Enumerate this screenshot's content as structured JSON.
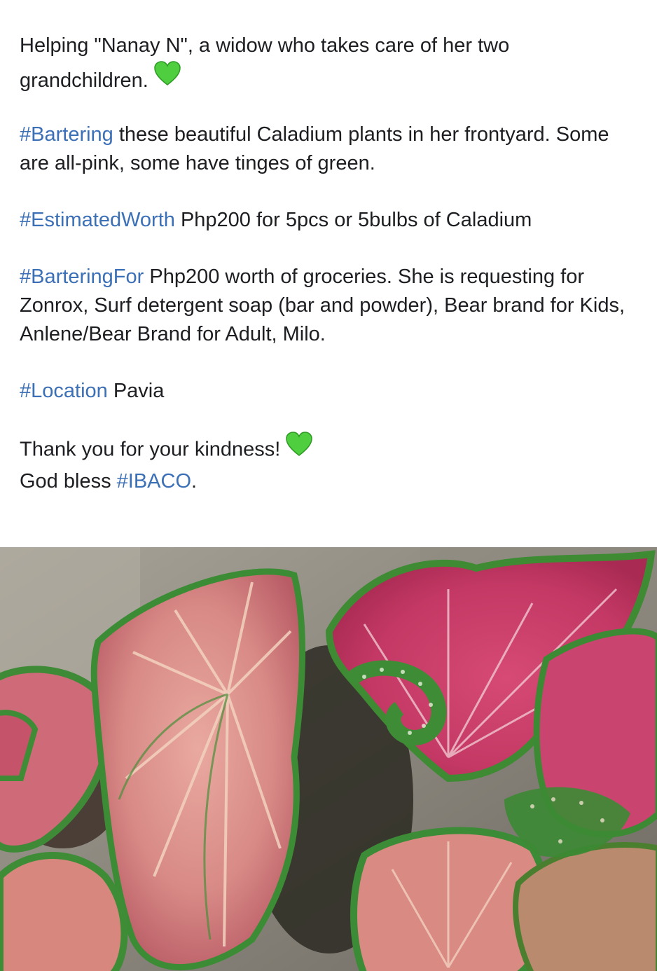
{
  "post": {
    "p1": {
      "text": "Helping \"Nanay N\", a widow who takes care of her two grandchildren.",
      "icon": "green-heart-icon"
    },
    "p2": {
      "tag": "#Bartering",
      "text": " these beautiful Caladium plants in her frontyard. Some are all-pink, some have tinges of green."
    },
    "p3": {
      "tag": "#EstimatedWorth",
      "text": " Php200 for 5pcs or 5bulbs of Caladium"
    },
    "p4": {
      "tag": "#BarteringFor",
      "text": " Php200 worth of groceries. She is requesting for Zonrox, Surf detergent soap (bar and powder), Bear brand for Kids, Anlene/Bear Brand for Adult, Milo."
    },
    "p5": {
      "tag": "#Location",
      "text": " Pavia"
    },
    "p6": {
      "line1": "Thank you for your kindness!",
      "icon": "green-heart-icon",
      "line2_prefix": "God bless ",
      "line2_tag": "#IBACO",
      "line2_suffix": "."
    }
  },
  "photo": {
    "subject": "caladium-plants-photo"
  },
  "colors": {
    "hashtag": "#3b6fb6",
    "text": "#1c1e21",
    "heart": "#4fcf3f"
  }
}
